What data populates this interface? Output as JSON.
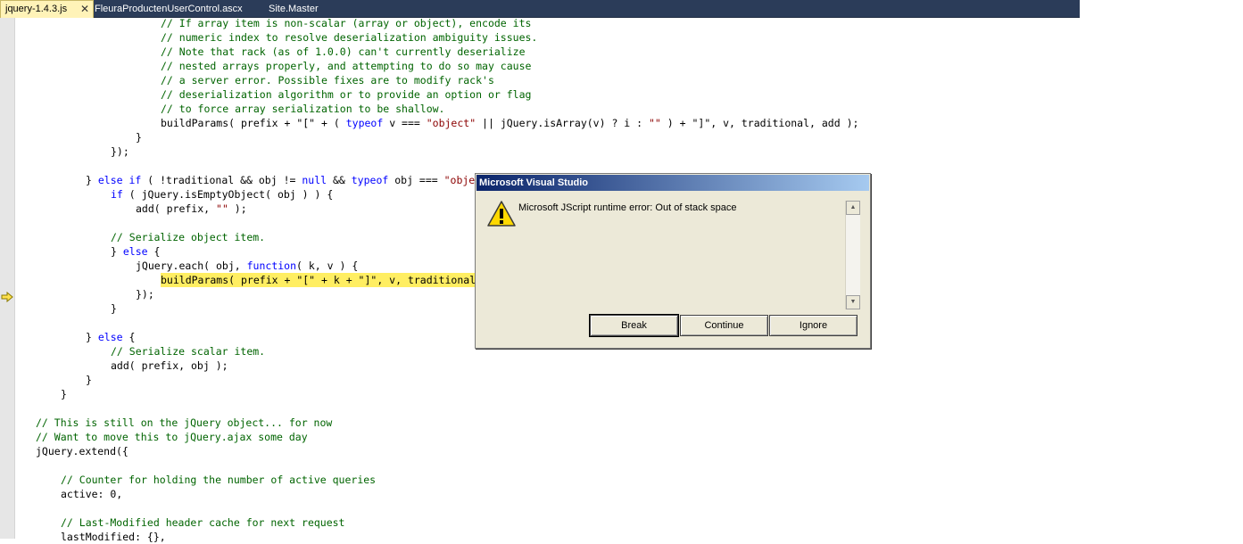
{
  "tabs": [
    {
      "label": "jquery-1.4.3.js",
      "active": true,
      "close_glyph": "✕"
    },
    {
      "label": "FleuraProductenUserControl.ascx"
    },
    {
      "label": "Site.Master"
    }
  ],
  "editor": {
    "current_line_icon": "yellow-arrow-icon",
    "lines": [
      {
        "indent": 4,
        "parts": [
          {
            "t": "// If array item is non-scalar (array or object), encode its",
            "c": "cm"
          }
        ]
      },
      {
        "indent": 4,
        "parts": [
          {
            "t": "// numeric index to resolve deserialization ambiguity issues.",
            "c": "cm"
          }
        ]
      },
      {
        "indent": 4,
        "parts": [
          {
            "t": "// Note that rack (as of 1.0.0) can't currently deserialize",
            "c": "cm"
          }
        ]
      },
      {
        "indent": 4,
        "parts": [
          {
            "t": "// nested arrays properly, and attempting to do so may cause",
            "c": "cm"
          }
        ]
      },
      {
        "indent": 4,
        "parts": [
          {
            "t": "// a server error. Possible fixes are to modify rack's",
            "c": "cm"
          }
        ]
      },
      {
        "indent": 4,
        "parts": [
          {
            "t": "// deserialization algorithm or to provide an option or flag",
            "c": "cm"
          }
        ]
      },
      {
        "indent": 4,
        "parts": [
          {
            "t": "// to force array serialization to be shallow.",
            "c": "cm"
          }
        ]
      },
      {
        "indent": 4,
        "parts": [
          {
            "t": "buildParams( prefix + \"[\" + ( "
          },
          {
            "t": "typeof",
            "c": "kw"
          },
          {
            "t": " v === "
          },
          {
            "t": "\"object\"",
            "c": "st"
          },
          {
            "t": " || jQuery.isArray(v) ? i : "
          },
          {
            "t": "\"\"",
            "c": "st"
          },
          {
            "t": " ) + \"]\", v, traditional, add );"
          }
        ]
      },
      {
        "indent": 3,
        "parts": [
          {
            "t": "}"
          }
        ]
      },
      {
        "indent": 2,
        "parts": [
          {
            "t": "});"
          }
        ]
      },
      {
        "indent": 0,
        "parts": []
      },
      {
        "indent": 1,
        "parts": [
          {
            "t": "} "
          },
          {
            "t": "else if",
            "c": "kw"
          },
          {
            "t": " ( !traditional && obj != "
          },
          {
            "t": "null",
            "c": "kw"
          },
          {
            "t": " && "
          },
          {
            "t": "typeof",
            "c": "kw"
          },
          {
            "t": " obj === "
          },
          {
            "t": "\"object\"",
            "c": "st"
          },
          {
            "t": " ) {"
          }
        ]
      },
      {
        "indent": 2,
        "parts": [
          {
            "t": "if",
            "c": "kw"
          },
          {
            "t": " ( jQuery.isEmptyObject( obj ) ) {"
          }
        ]
      },
      {
        "indent": 3,
        "parts": [
          {
            "t": "add( prefix, "
          },
          {
            "t": "\"\"",
            "c": "st"
          },
          {
            "t": " );"
          }
        ]
      },
      {
        "indent": 0,
        "parts": []
      },
      {
        "indent": 2,
        "parts": [
          {
            "t": "// Serialize object item.",
            "c": "cm"
          }
        ]
      },
      {
        "indent": 2,
        "parts": [
          {
            "t": "} "
          },
          {
            "t": "else",
            "c": "kw"
          },
          {
            "t": " {"
          }
        ]
      },
      {
        "indent": 3,
        "parts": [
          {
            "t": "jQuery.each( obj, "
          },
          {
            "t": "function",
            "c": "kw"
          },
          {
            "t": "( k, v ) {"
          }
        ]
      },
      {
        "indent": 4,
        "highlight": true,
        "parts": [
          {
            "t": "buildParams( prefix + \"[\" + k + \"]\", v, traditional, add );"
          }
        ]
      },
      {
        "indent": 3,
        "parts": [
          {
            "t": "});"
          }
        ]
      },
      {
        "indent": 2,
        "parts": [
          {
            "t": "}"
          }
        ]
      },
      {
        "indent": 0,
        "parts": []
      },
      {
        "indent": 1,
        "parts": [
          {
            "t": "} "
          },
          {
            "t": "else",
            "c": "kw"
          },
          {
            "t": " {"
          }
        ]
      },
      {
        "indent": 2,
        "parts": [
          {
            "t": "// Serialize scalar item.",
            "c": "cm"
          }
        ]
      },
      {
        "indent": 2,
        "parts": [
          {
            "t": "add( prefix, obj );"
          }
        ]
      },
      {
        "indent": 1,
        "parts": [
          {
            "t": "}"
          }
        ]
      },
      {
        "indent": 0,
        "parts": [
          {
            "t": "}"
          }
        ]
      },
      {
        "indent": 0,
        "parts": []
      },
      {
        "indent": -1,
        "parts": [
          {
            "t": "// This is still on the jQuery object... for now",
            "c": "cm"
          }
        ]
      },
      {
        "indent": -1,
        "parts": [
          {
            "t": "// Want to move this to jQuery.ajax some day",
            "c": "cm"
          }
        ]
      },
      {
        "indent": -1,
        "parts": [
          {
            "t": "jQuery.extend({"
          }
        ]
      },
      {
        "indent": 0,
        "parts": []
      },
      {
        "indent": 0,
        "parts": [
          {
            "t": "// Counter for holding the number of active queries",
            "c": "cm"
          }
        ]
      },
      {
        "indent": 0,
        "parts": [
          {
            "t": "active: 0,"
          }
        ]
      },
      {
        "indent": 0,
        "parts": []
      },
      {
        "indent": 0,
        "parts": [
          {
            "t": "// Last-Modified header cache for next request",
            "c": "cm"
          }
        ]
      },
      {
        "indent": 0,
        "parts": [
          {
            "t": "lastModified: {},"
          }
        ]
      }
    ]
  },
  "dialog": {
    "title": "Microsoft Visual Studio",
    "icon": "warning-icon",
    "message": "Microsoft JScript runtime error: Out of stack space",
    "buttons": {
      "break_label": "Break",
      "continue_label": "Continue",
      "ignore_label": "Ignore"
    },
    "scroll_up_glyph": "▲",
    "scroll_down_glyph": "▼"
  },
  "colors": {
    "comment": "#006400",
    "keyword": "#0000ff",
    "string": "#8b0000",
    "current_line": "#ffee62"
  }
}
